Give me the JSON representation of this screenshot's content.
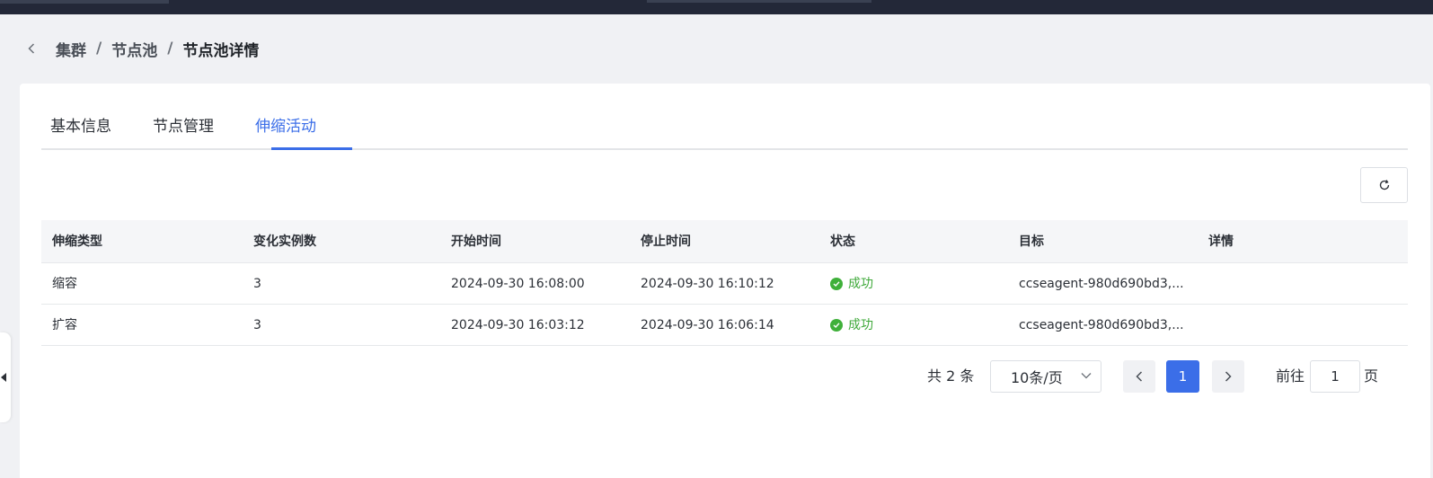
{
  "breadcrumb": {
    "items": [
      "集群",
      "节点池",
      "节点池详情"
    ],
    "separator": "/"
  },
  "tabs": [
    {
      "label": "基本信息",
      "active": false
    },
    {
      "label": "节点管理",
      "active": false
    },
    {
      "label": "伸缩活动",
      "active": true
    }
  ],
  "table": {
    "headers": [
      "伸缩类型",
      "变化实例数",
      "开始时间",
      "停止时间",
      "状态",
      "目标",
      "详情"
    ],
    "rows": [
      {
        "type": "缩容",
        "count": "3",
        "start": "2024-09-30 16:08:00",
        "stop": "2024-09-30 16:10:12",
        "status": "成功",
        "target": "ccseagent-980d690bd3,...",
        "detail": ""
      },
      {
        "type": "扩容",
        "count": "3",
        "start": "2024-09-30 16:03:12",
        "stop": "2024-09-30 16:06:14",
        "status": "成功",
        "target": "ccseagent-980d690bd3,...",
        "detail": ""
      }
    ]
  },
  "pagination": {
    "total_text": "共 2 条",
    "page_size": "10条/页",
    "current_page": "1",
    "goto_label": "前往",
    "goto_value": "1",
    "page_unit": "页"
  },
  "colors": {
    "accent": "#3b6ee8",
    "success": "#3fb03a"
  }
}
